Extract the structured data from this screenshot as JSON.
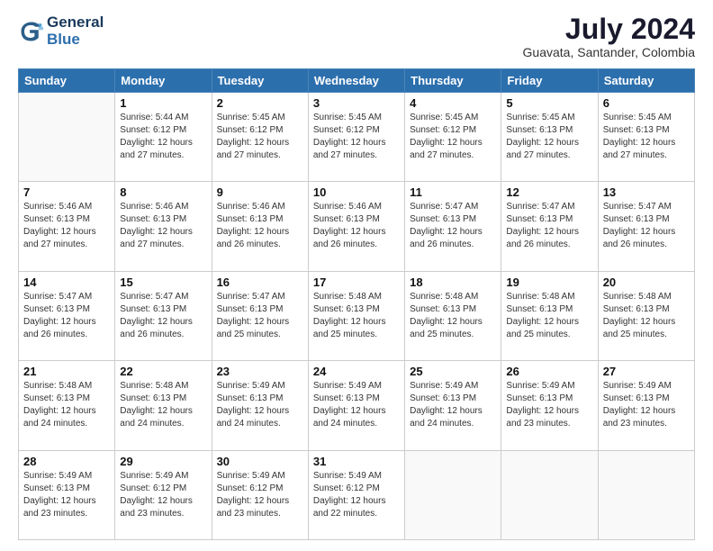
{
  "logo": {
    "line1": "General",
    "line2": "Blue"
  },
  "header": {
    "month_year": "July 2024",
    "location": "Guavata, Santander, Colombia"
  },
  "days_of_week": [
    "Sunday",
    "Monday",
    "Tuesday",
    "Wednesday",
    "Thursday",
    "Friday",
    "Saturday"
  ],
  "weeks": [
    [
      {
        "day": "",
        "info": ""
      },
      {
        "day": "1",
        "info": "Sunrise: 5:44 AM\nSunset: 6:12 PM\nDaylight: 12 hours\nand 27 minutes."
      },
      {
        "day": "2",
        "info": "Sunrise: 5:45 AM\nSunset: 6:12 PM\nDaylight: 12 hours\nand 27 minutes."
      },
      {
        "day": "3",
        "info": "Sunrise: 5:45 AM\nSunset: 6:12 PM\nDaylight: 12 hours\nand 27 minutes."
      },
      {
        "day": "4",
        "info": "Sunrise: 5:45 AM\nSunset: 6:12 PM\nDaylight: 12 hours\nand 27 minutes."
      },
      {
        "day": "5",
        "info": "Sunrise: 5:45 AM\nSunset: 6:13 PM\nDaylight: 12 hours\nand 27 minutes."
      },
      {
        "day": "6",
        "info": "Sunrise: 5:45 AM\nSunset: 6:13 PM\nDaylight: 12 hours\nand 27 minutes."
      }
    ],
    [
      {
        "day": "7",
        "info": "Sunrise: 5:46 AM\nSunset: 6:13 PM\nDaylight: 12 hours\nand 27 minutes."
      },
      {
        "day": "8",
        "info": "Sunrise: 5:46 AM\nSunset: 6:13 PM\nDaylight: 12 hours\nand 27 minutes."
      },
      {
        "day": "9",
        "info": "Sunrise: 5:46 AM\nSunset: 6:13 PM\nDaylight: 12 hours\nand 26 minutes."
      },
      {
        "day": "10",
        "info": "Sunrise: 5:46 AM\nSunset: 6:13 PM\nDaylight: 12 hours\nand 26 minutes."
      },
      {
        "day": "11",
        "info": "Sunrise: 5:47 AM\nSunset: 6:13 PM\nDaylight: 12 hours\nand 26 minutes."
      },
      {
        "day": "12",
        "info": "Sunrise: 5:47 AM\nSunset: 6:13 PM\nDaylight: 12 hours\nand 26 minutes."
      },
      {
        "day": "13",
        "info": "Sunrise: 5:47 AM\nSunset: 6:13 PM\nDaylight: 12 hours\nand 26 minutes."
      }
    ],
    [
      {
        "day": "14",
        "info": "Sunrise: 5:47 AM\nSunset: 6:13 PM\nDaylight: 12 hours\nand 26 minutes."
      },
      {
        "day": "15",
        "info": "Sunrise: 5:47 AM\nSunset: 6:13 PM\nDaylight: 12 hours\nand 26 minutes."
      },
      {
        "day": "16",
        "info": "Sunrise: 5:47 AM\nSunset: 6:13 PM\nDaylight: 12 hours\nand 25 minutes."
      },
      {
        "day": "17",
        "info": "Sunrise: 5:48 AM\nSunset: 6:13 PM\nDaylight: 12 hours\nand 25 minutes."
      },
      {
        "day": "18",
        "info": "Sunrise: 5:48 AM\nSunset: 6:13 PM\nDaylight: 12 hours\nand 25 minutes."
      },
      {
        "day": "19",
        "info": "Sunrise: 5:48 AM\nSunset: 6:13 PM\nDaylight: 12 hours\nand 25 minutes."
      },
      {
        "day": "20",
        "info": "Sunrise: 5:48 AM\nSunset: 6:13 PM\nDaylight: 12 hours\nand 25 minutes."
      }
    ],
    [
      {
        "day": "21",
        "info": "Sunrise: 5:48 AM\nSunset: 6:13 PM\nDaylight: 12 hours\nand 24 minutes."
      },
      {
        "day": "22",
        "info": "Sunrise: 5:48 AM\nSunset: 6:13 PM\nDaylight: 12 hours\nand 24 minutes."
      },
      {
        "day": "23",
        "info": "Sunrise: 5:49 AM\nSunset: 6:13 PM\nDaylight: 12 hours\nand 24 minutes."
      },
      {
        "day": "24",
        "info": "Sunrise: 5:49 AM\nSunset: 6:13 PM\nDaylight: 12 hours\nand 24 minutes."
      },
      {
        "day": "25",
        "info": "Sunrise: 5:49 AM\nSunset: 6:13 PM\nDaylight: 12 hours\nand 24 minutes."
      },
      {
        "day": "26",
        "info": "Sunrise: 5:49 AM\nSunset: 6:13 PM\nDaylight: 12 hours\nand 23 minutes."
      },
      {
        "day": "27",
        "info": "Sunrise: 5:49 AM\nSunset: 6:13 PM\nDaylight: 12 hours\nand 23 minutes."
      }
    ],
    [
      {
        "day": "28",
        "info": "Sunrise: 5:49 AM\nSunset: 6:13 PM\nDaylight: 12 hours\nand 23 minutes."
      },
      {
        "day": "29",
        "info": "Sunrise: 5:49 AM\nSunset: 6:12 PM\nDaylight: 12 hours\nand 23 minutes."
      },
      {
        "day": "30",
        "info": "Sunrise: 5:49 AM\nSunset: 6:12 PM\nDaylight: 12 hours\nand 23 minutes."
      },
      {
        "day": "31",
        "info": "Sunrise: 5:49 AM\nSunset: 6:12 PM\nDaylight: 12 hours\nand 22 minutes."
      },
      {
        "day": "",
        "info": ""
      },
      {
        "day": "",
        "info": ""
      },
      {
        "day": "",
        "info": ""
      }
    ]
  ]
}
